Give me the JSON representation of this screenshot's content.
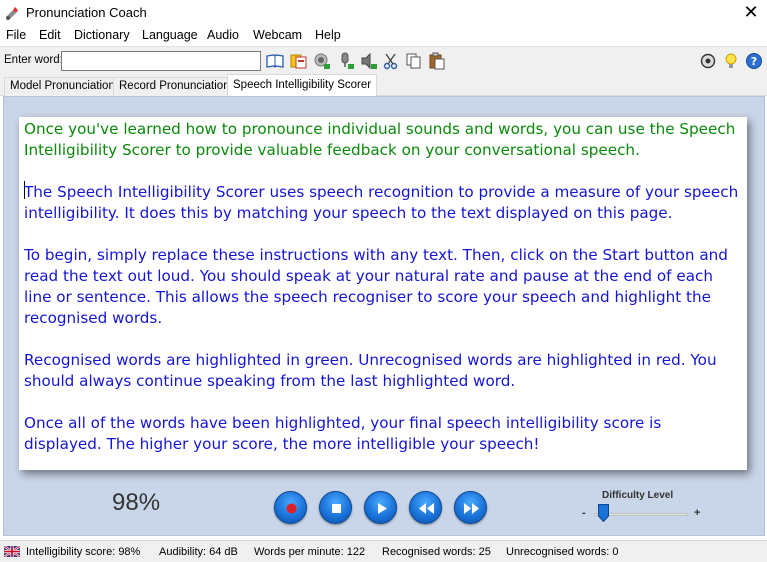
{
  "window": {
    "title": "Pronunciation Coach",
    "close_glyph": "✕"
  },
  "menu": [
    "File",
    "Edit",
    "Dictionary",
    "Language",
    "Audio",
    "Webcam",
    "Help"
  ],
  "toolbar": {
    "enter_word_label": "Enter word:",
    "word_value": "",
    "icons": [
      "dictionary-icon",
      "flashcards-icon",
      "listen-icon",
      "record-icon",
      "speaker-icon",
      "cut-icon",
      "copy-icon",
      "paste-icon"
    ],
    "right_icons": [
      "settings-icon",
      "tip-icon",
      "help-icon"
    ]
  },
  "tabs": [
    {
      "label": "Model Pronunciation",
      "active": false
    },
    {
      "label": "Record Pronunciation",
      "active": false
    },
    {
      "label": "Speech Intelligibility Scorer",
      "active": true
    }
  ],
  "document": {
    "intro": "Once you've learned how to pronounce individual sounds and words, you can use the Speech Intelligibility Scorer to provide valuable feedback on your conversational speech.",
    "paragraphs": [
      "The Speech Intelligibility Scorer uses speech recognition to provide a measure of your speech intelligibility. It does this by matching your speech to the text displayed on this page.",
      "To begin, simply replace these instructions with any text. Then, click on the Start button and read the text out loud. You should speak at your natural rate and pause at the end of each line or sentence. This allows the speech recogniser to score your speech and highlight the recognised words.",
      "Recognised words are highlighted in green. Unrecognised words are highlighted in red. You should always continue speaking from the last highlighted word.",
      "Once all of the words have been highlighted, your final speech intelligibility score is displayed. The higher your score, the more intelligible your speech!"
    ]
  },
  "controls": {
    "score": "98%",
    "buttons": [
      "record-button",
      "stop-button",
      "play-button",
      "rewind-button",
      "fast-forward-button"
    ],
    "difficulty_label": "Difficulty Level",
    "difficulty_min": "-",
    "difficulty_max": "+",
    "difficulty_value": 0.1
  },
  "status": {
    "intelligibility": "Intelligibility score: 98%",
    "audibility": "Audibility: 64 dB",
    "wpm": "Words per minute: 122",
    "recognised": "Recognised words: 25",
    "unrecognised": "Unrecognised words: 0"
  },
  "colors": {
    "intro_text": "#0a8a0a",
    "body_text": "#1515d6",
    "work_bg": "#c9d5e8",
    "button_blue": "#1a73d9",
    "record_dot": "#e0202a"
  }
}
